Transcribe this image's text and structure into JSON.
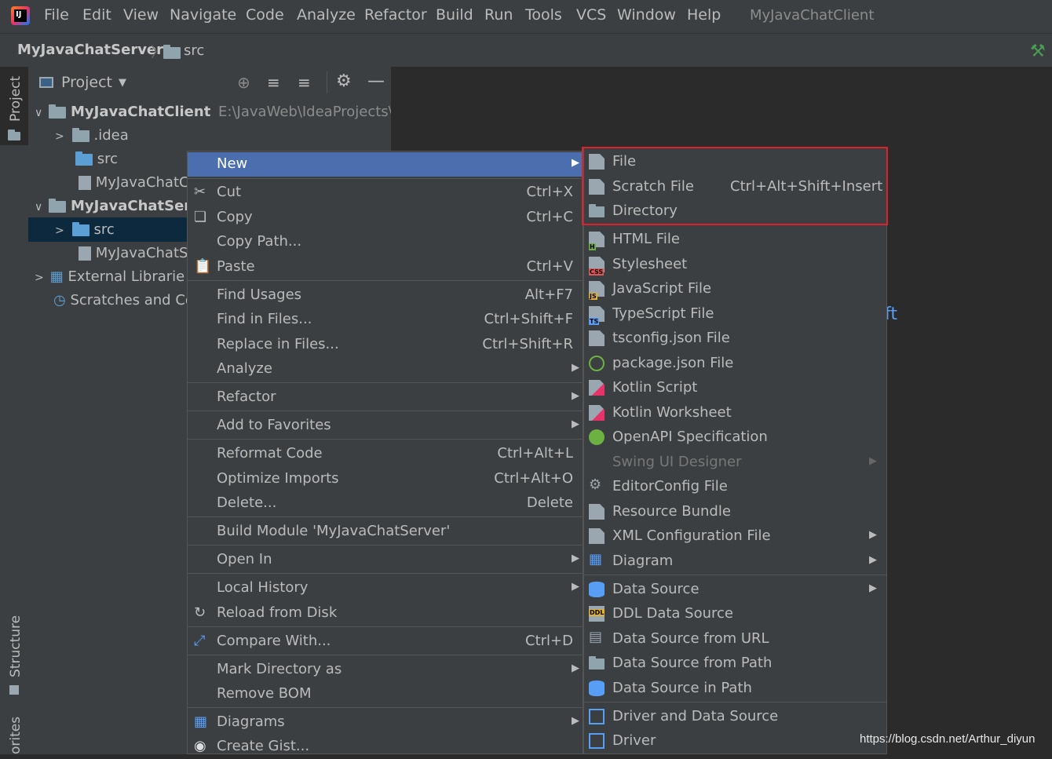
{
  "menubar": {
    "items": [
      "File",
      "Edit",
      "View",
      "Navigate",
      "Code",
      "Analyze",
      "Refactor",
      "Build",
      "Run",
      "Tools",
      "VCS",
      "Window",
      "Help"
    ],
    "window_title": "MyJavaChatClient",
    "logo_text": "IJ"
  },
  "navbar": {
    "breadcrumb_project": "MyJavaChatServer",
    "breadcrumb_separator": "〉",
    "breadcrumb_folder": "src"
  },
  "left_strip": {
    "project_tab": "Project",
    "structure_tab": "Structure",
    "favorites_tab": "orites"
  },
  "project_panel": {
    "title": "Project",
    "tree": [
      {
        "label": "MyJavaChatClient",
        "path": "E:\\JavaWeb\\IdeaProjects\\w"
      },
      {
        "label": ".idea"
      },
      {
        "label": "src"
      },
      {
        "label": "MyJavaChatC"
      },
      {
        "label": "MyJavaChatServ"
      },
      {
        "label": "src"
      },
      {
        "label": "MyJavaChatS"
      },
      {
        "label": "External Librarie"
      },
      {
        "label": "Scratches and Co"
      }
    ]
  },
  "context_menu": {
    "items": [
      {
        "label": "New",
        "shortcut": "",
        "submenu": true,
        "selected": true
      },
      {
        "label": "Cut",
        "shortcut": "Ctrl+X",
        "icon": "scissors-icon"
      },
      {
        "label": "Copy",
        "shortcut": "Ctrl+C",
        "icon": "copy-icon"
      },
      {
        "label": "Copy Path...",
        "shortcut": ""
      },
      {
        "label": "Paste",
        "shortcut": "Ctrl+V",
        "icon": "paste-icon"
      },
      {
        "label": "Find Usages",
        "shortcut": "Alt+F7"
      },
      {
        "label": "Find in Files...",
        "shortcut": "Ctrl+Shift+F"
      },
      {
        "label": "Replace in Files...",
        "shortcut": "Ctrl+Shift+R"
      },
      {
        "label": "Analyze",
        "shortcut": "",
        "submenu": true
      },
      {
        "label": "Refactor",
        "shortcut": "",
        "submenu": true
      },
      {
        "label": "Add to Favorites",
        "shortcut": "",
        "submenu": true
      },
      {
        "label": "Reformat Code",
        "shortcut": "Ctrl+Alt+L"
      },
      {
        "label": "Optimize Imports",
        "shortcut": "Ctrl+Alt+O"
      },
      {
        "label": "Delete...",
        "shortcut": "Delete"
      },
      {
        "label": "Build Module 'MyJavaChatServer'",
        "shortcut": ""
      },
      {
        "label": "Open In",
        "shortcut": "",
        "submenu": true
      },
      {
        "label": "Local History",
        "shortcut": "",
        "submenu": true
      },
      {
        "label": "Reload from Disk",
        "shortcut": "",
        "icon": "reload-icon"
      },
      {
        "label": "Compare With...",
        "shortcut": "Ctrl+D",
        "icon": "compare-icon"
      },
      {
        "label": "Mark Directory as",
        "shortcut": "",
        "submenu": true
      },
      {
        "label": "Remove BOM",
        "shortcut": ""
      },
      {
        "label": "Diagrams",
        "shortcut": "",
        "submenu": true,
        "icon": "diagram-icon"
      },
      {
        "label": "Create Gist...",
        "shortcut": "",
        "icon": "github-icon"
      }
    ]
  },
  "new_submenu": {
    "items": [
      {
        "label": "File",
        "shortcut": ""
      },
      {
        "label": "Scratch File",
        "shortcut": "Ctrl+Alt+Shift+Insert"
      },
      {
        "label": "Directory",
        "shortcut": ""
      },
      {
        "label": "HTML File",
        "badge": "H"
      },
      {
        "label": "Stylesheet",
        "badge": "CSS"
      },
      {
        "label": "JavaScript File",
        "badge": "JS"
      },
      {
        "label": "TypeScript File",
        "badge": "TS"
      },
      {
        "label": "tsconfig.json File"
      },
      {
        "label": "package.json File"
      },
      {
        "label": "Kotlin Script"
      },
      {
        "label": "Kotlin Worksheet"
      },
      {
        "label": "OpenAPI Specification"
      },
      {
        "label": "Swing UI Designer",
        "disabled": true,
        "submenu": true
      },
      {
        "label": "EditorConfig File"
      },
      {
        "label": "Resource Bundle"
      },
      {
        "label": "XML Configuration File",
        "submenu": true
      },
      {
        "label": "Diagram",
        "submenu": true
      },
      {
        "label": "Data Source",
        "submenu": true
      },
      {
        "label": "DDL Data Source",
        "badge": "DDL"
      },
      {
        "label": "Data Source from URL"
      },
      {
        "label": "Data Source from Path"
      },
      {
        "label": "Data Source in Path"
      },
      {
        "label": "Driver and Data Source"
      },
      {
        "label": "Driver"
      }
    ]
  },
  "editor_fragment": "ft",
  "watermark": "https://blog.csdn.net/Arthur_diyun",
  "colors": {
    "accent": "#4b6eaf",
    "highlight_box": "#e0202a",
    "panel": "#3c3f41",
    "editor": "#2b2b2b"
  }
}
